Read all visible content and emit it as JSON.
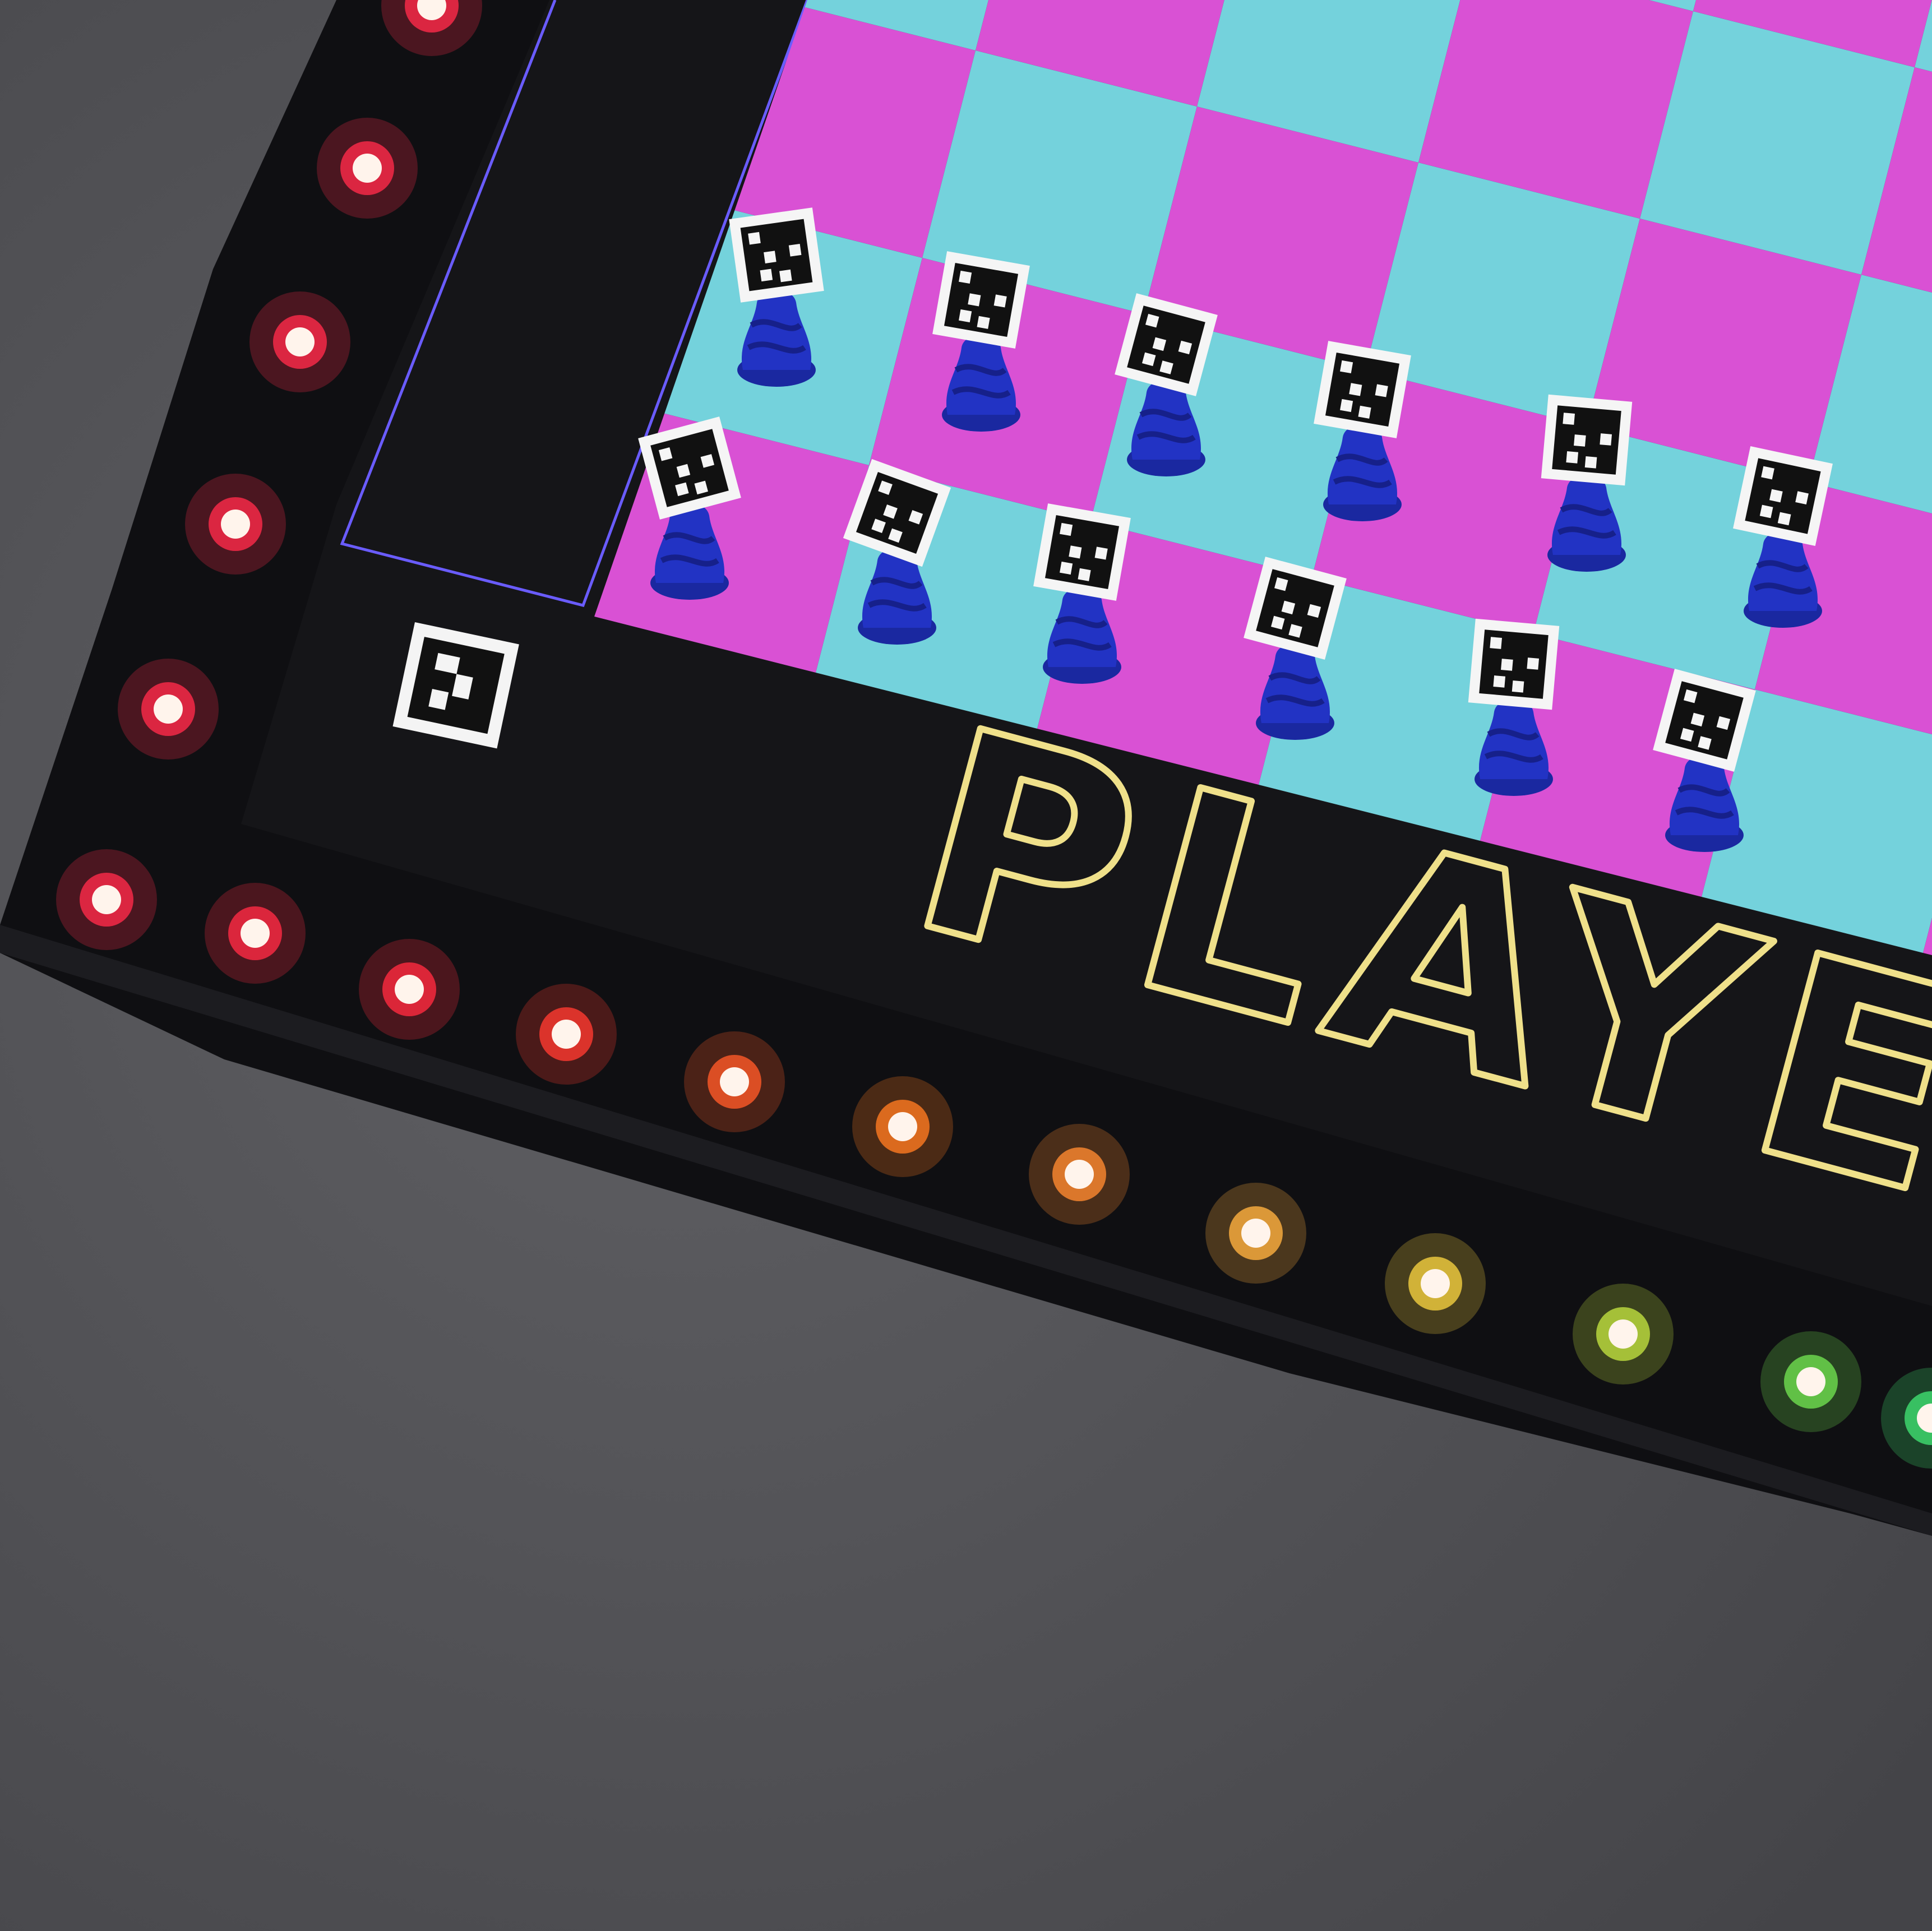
{
  "photo": {
    "subject": "chessboard-corner",
    "board_label": "PLAYER",
    "colors": {
      "light_square": "#74d2dc",
      "dark_square": "#d951d4",
      "frame": "#141417",
      "outline_text": "#efe08a",
      "piece": "#2233c4",
      "background": "#535357"
    },
    "led_colors": {
      "left_column": [
        "#ff2a4a",
        "#ff2a4a",
        "#ff2a4a",
        "#ff2a4a",
        "#ff2a4a",
        "#ff2a4a"
      ],
      "bottom_row": [
        "#ff2a44",
        "#ff2a40",
        "#ff3a30",
        "#ff5a28",
        "#ff7a20",
        "#ff8a30",
        "#ffb040",
        "#f4d040",
        "#c0e040",
        "#70e050",
        "#40e070"
      ]
    }
  }
}
